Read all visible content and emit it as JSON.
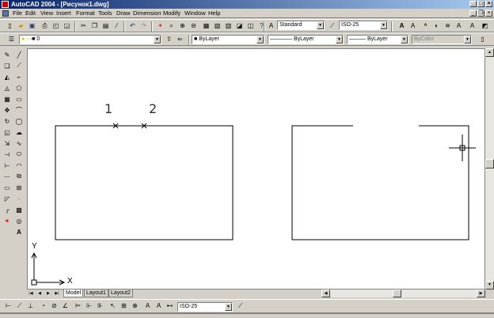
{
  "window": {
    "title": "AutoCAD 2004 - [Рисунок1.dwg]"
  },
  "menu": [
    "File",
    "Edit",
    "View",
    "Insert",
    "Format",
    "Tools",
    "Draw",
    "Dimension",
    "Modify",
    "Window",
    "Help"
  ],
  "styles_toolbar": {
    "text_style": "Standard",
    "dim_style": "ISO-25"
  },
  "layer_toolbar": {
    "layer": "0"
  },
  "properties_toolbar": {
    "color": "ByLayer",
    "linetype": "ByLayer",
    "lineweight": "ByLayer",
    "plotstyle": "ByColor"
  },
  "drawing": {
    "point_labels": [
      "1",
      "2"
    ],
    "ucs_x": "X",
    "ucs_y": "Y"
  },
  "tabs": [
    "Model",
    "Layout1",
    "Layout2"
  ],
  "dim_toolbar": {
    "dim_style": "ISO-25"
  }
}
